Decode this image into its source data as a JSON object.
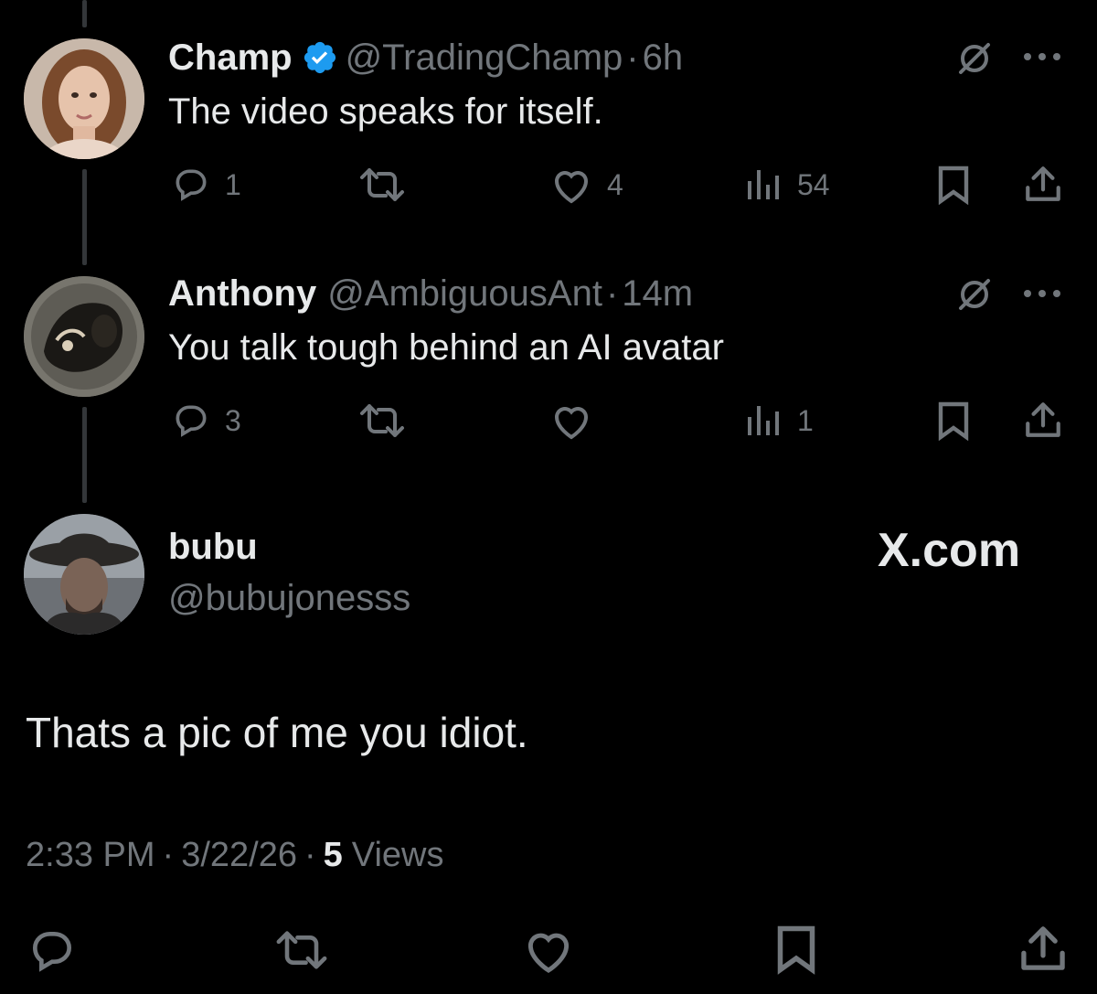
{
  "tweets": [
    {
      "name": "Champ",
      "verified": true,
      "handle": "@TradingChamp",
      "time": "6h",
      "text": "The video speaks for itself.",
      "replies": "1",
      "likes": "4",
      "views": "54"
    },
    {
      "name": "Anthony",
      "verified": false,
      "handle": "@AmbiguousAnt",
      "time": "14m",
      "text": "You talk tough behind an AI avatar",
      "replies": "3",
      "likes": "",
      "views": "1"
    }
  ],
  "main": {
    "name": "bubu",
    "handle": "@bubujonesss",
    "text": "Thats a pic of me you idiot.",
    "time": "2:33 PM",
    "date": "3/22/26",
    "views_count": "5",
    "views_label": "Views",
    "separator": "·"
  },
  "watermark": "X.com",
  "colors": {
    "background": "#000000",
    "text": "#e7e9ea",
    "muted": "#71767b",
    "verified": "#1d9bf0"
  },
  "icons": [
    "reply-icon",
    "retweet-icon",
    "like-icon",
    "views-icon",
    "bookmark-icon",
    "share-icon",
    "grok-icon",
    "more-icon",
    "verified-badge-icon"
  ]
}
